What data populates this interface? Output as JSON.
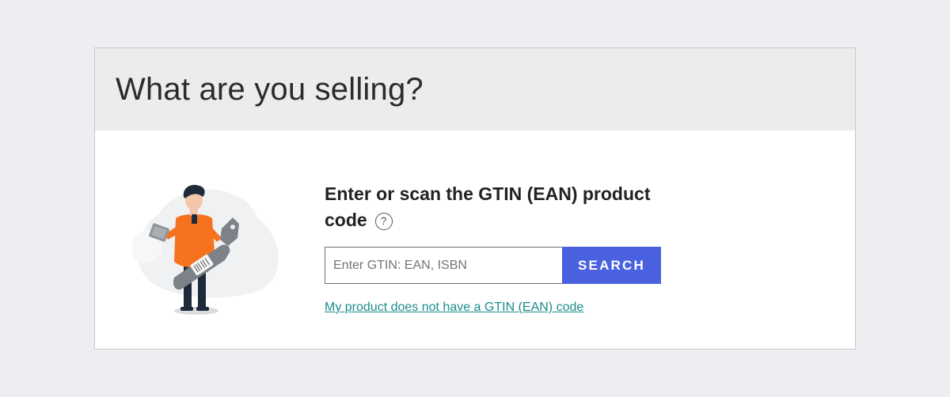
{
  "page": {
    "title": "What are you selling?"
  },
  "form": {
    "heading_line1": "Enter or scan the GTIN (EAN) product",
    "heading_line2": "code",
    "help_icon_glyph": "?",
    "input_placeholder": "Enter GTIN: EAN, ISBN",
    "input_value": "",
    "search_label": "SEARCH",
    "no_gtin_link": "My product does not have a GTIN (EAN) code"
  },
  "icons": {
    "help": "question-circle-icon",
    "illustration": "person-scanning-product-illustration"
  },
  "colors": {
    "background": "#eceef1",
    "header_bg": "#ececec",
    "search_button": "#4a62e0",
    "link": "#1c8c8c",
    "illustration_accent": "#f5731f"
  }
}
